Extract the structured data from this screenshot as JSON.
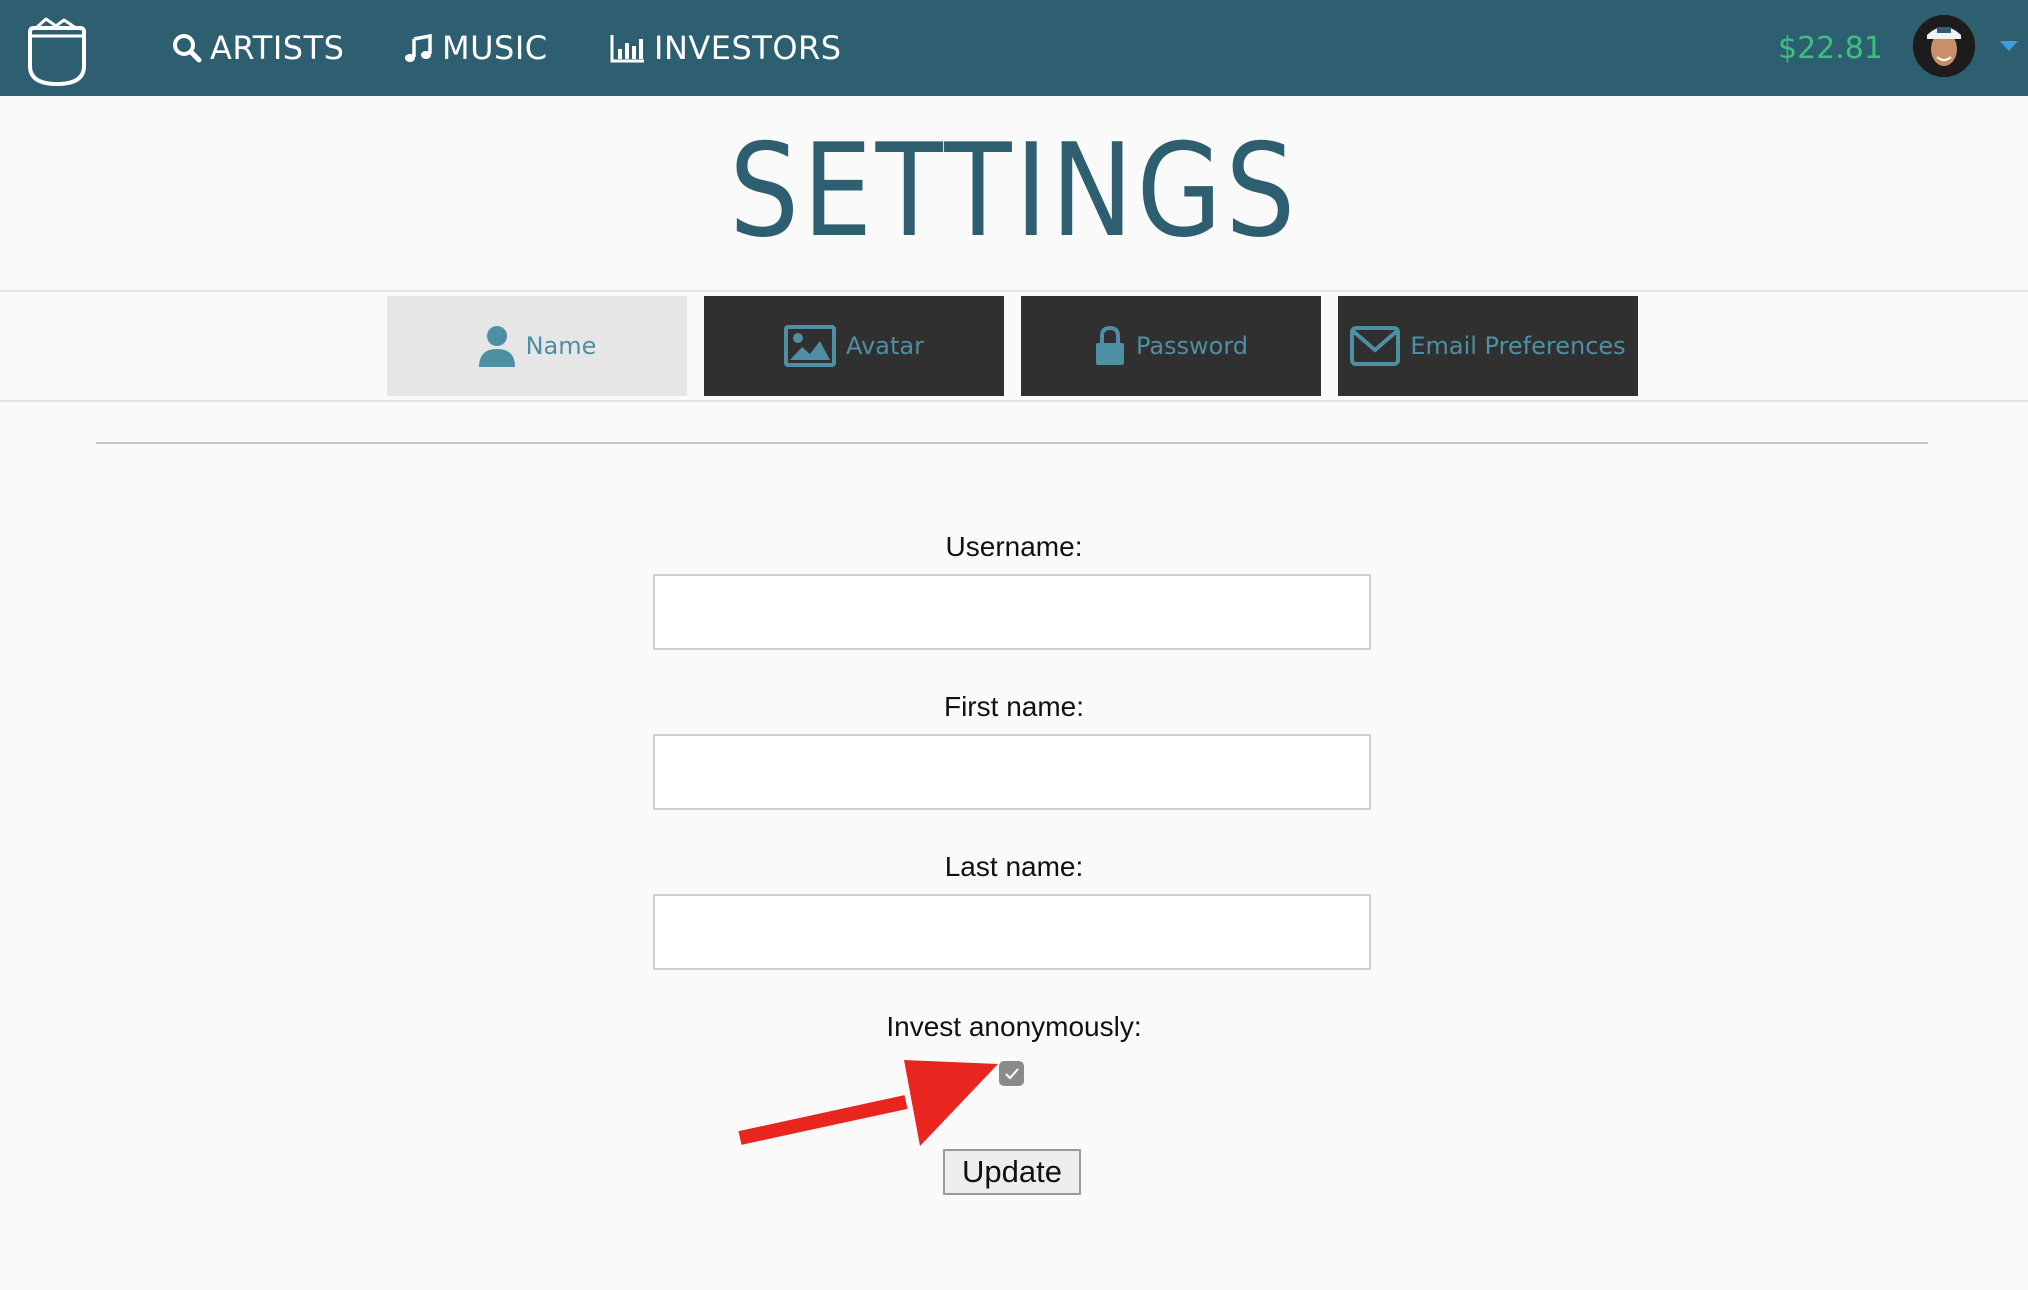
{
  "nav": {
    "items": [
      {
        "label": "ARTISTS",
        "icon": "search-icon"
      },
      {
        "label": "MUSIC",
        "icon": "music-note-icon"
      },
      {
        "label": "INVESTORS",
        "icon": "bar-chart-icon"
      }
    ],
    "balance": "$22.81",
    "logo_icon": "pocket-logo-icon",
    "avatar_icon": "user-avatar",
    "menu_icon": "chevron-down-icon"
  },
  "page": {
    "title": "SETTINGS"
  },
  "tabs": [
    {
      "label": "Name",
      "icon": "user-icon",
      "active": true
    },
    {
      "label": "Avatar",
      "icon": "image-icon",
      "active": false
    },
    {
      "label": "Password",
      "icon": "lock-icon",
      "active": false
    },
    {
      "label": "Email Preferences",
      "icon": "envelope-icon",
      "active": false
    }
  ],
  "form": {
    "username": {
      "label": "Username:",
      "value": ""
    },
    "first_name": {
      "label": "First name:",
      "value": ""
    },
    "last_name": {
      "label": "Last name:",
      "value": ""
    },
    "invest_anonymously": {
      "label": "Invest anonymously:",
      "checked": true
    },
    "submit_label": "Update"
  },
  "annotation": {
    "type": "red-arrow",
    "points_to": "invest-anonymously-checkbox"
  },
  "colors": {
    "header_bg": "#2d5f70",
    "balance": "#3fbf7f",
    "tab_inactive_bg": "#303030",
    "tab_active_bg": "#e6e6e6",
    "tab_text": "#4d8fa3",
    "arrow": "#e8261f"
  }
}
